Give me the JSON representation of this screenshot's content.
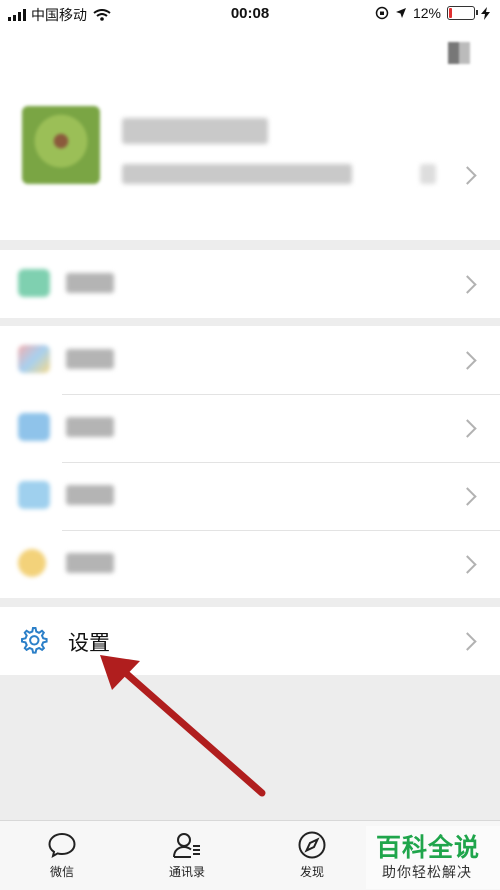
{
  "status_bar": {
    "carrier": "中国移动",
    "time": "00:08",
    "battery_percent": "12%",
    "battery_level": 0.12
  },
  "me_page": {
    "settings_label": "设置"
  },
  "tab_bar": {
    "tabs": [
      {
        "label": "微信",
        "icon": "chat-bubble-icon"
      },
      {
        "label": "通讯录",
        "icon": "contacts-icon"
      },
      {
        "label": "发现",
        "icon": "compass-icon"
      }
    ]
  },
  "watermark": {
    "title": "百科全说",
    "subtitle": "助你轻松解决"
  },
  "colors": {
    "arrow": "#b01e1e",
    "settings_icon": "#2b7fc8",
    "watermark_green": "#1fa54b",
    "battery_low": "#e03030"
  }
}
